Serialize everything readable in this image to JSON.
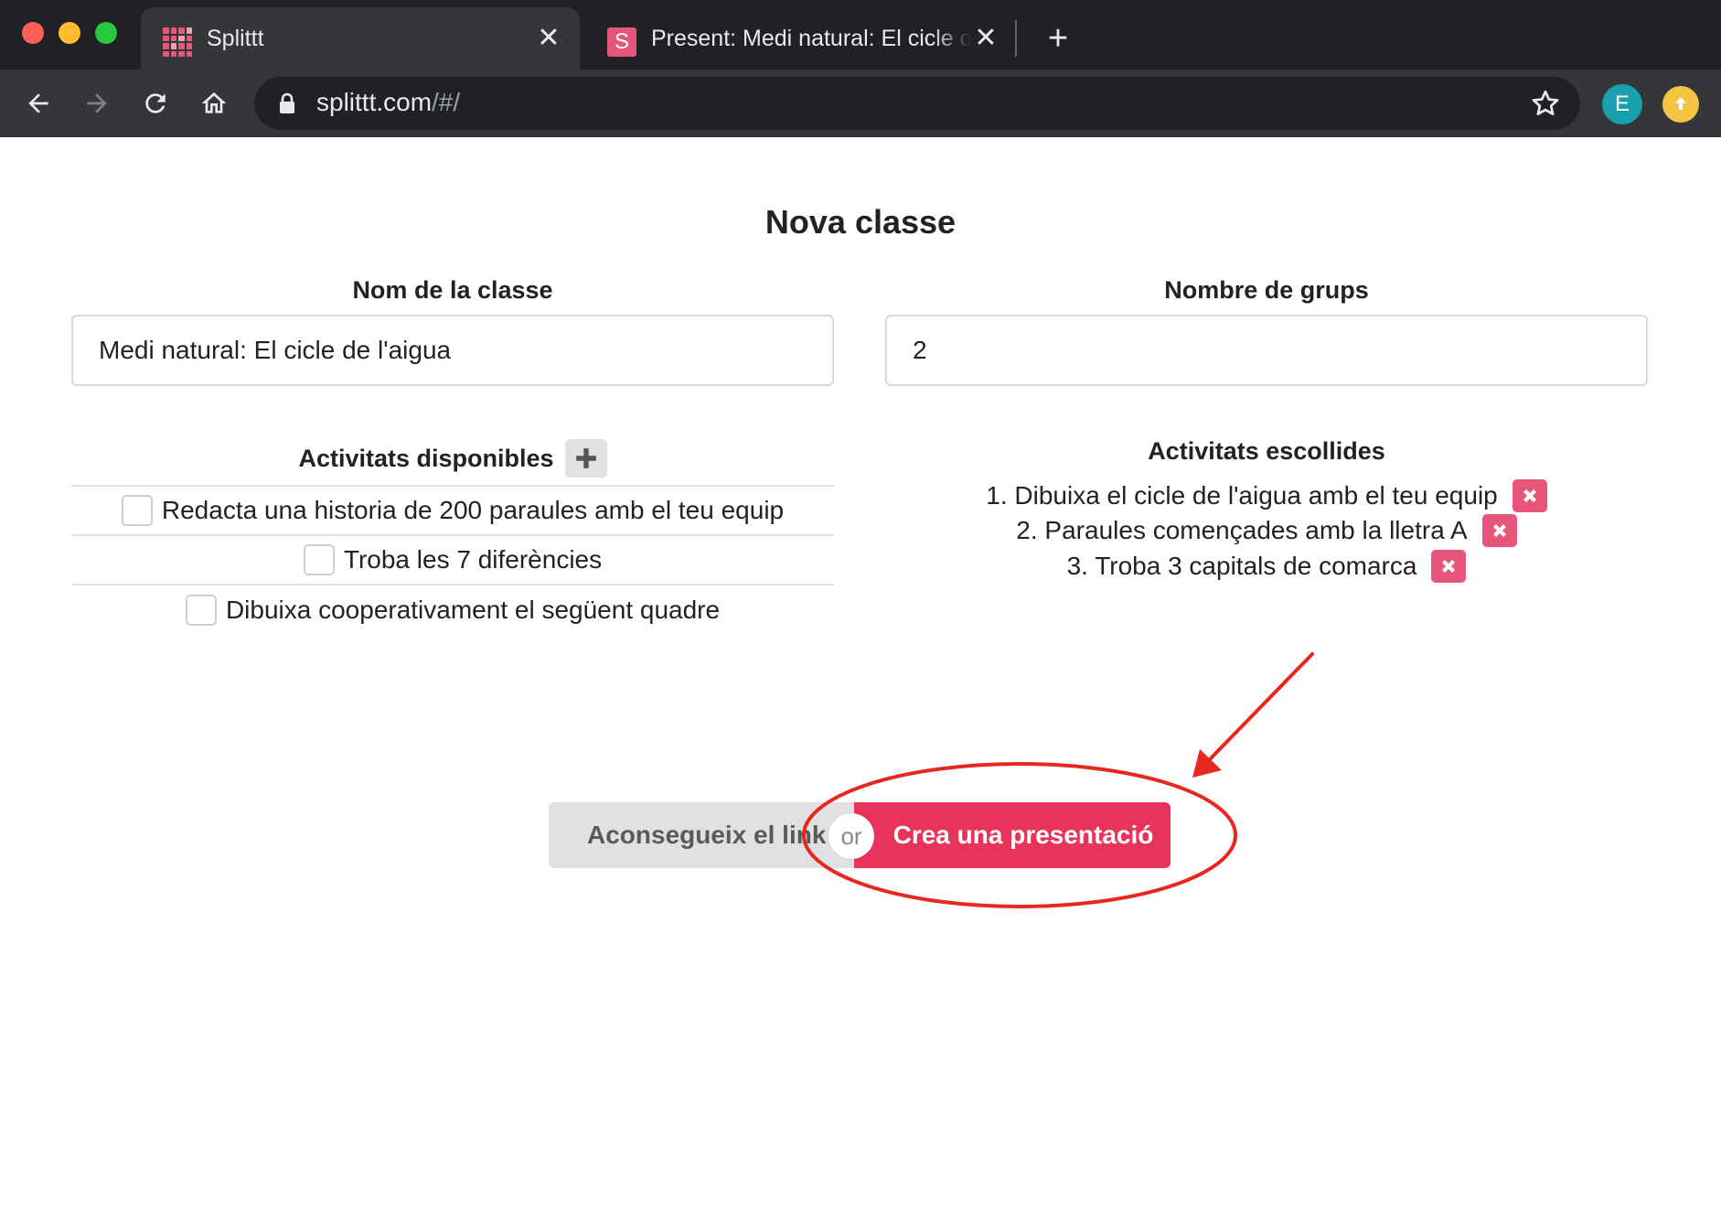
{
  "browser": {
    "tabs": [
      {
        "title": "Splittt",
        "favicon": "splittt-grid-icon",
        "active": true
      },
      {
        "title": "Present: Medi natural: El cicle de l'aigua",
        "favicon_letter": "S",
        "active": false
      }
    ],
    "url_host": "splittt.com",
    "url_path": "/#/",
    "profile_initial": "E"
  },
  "page": {
    "title": "Nova classe",
    "class_name_label": "Nom de la classe",
    "class_name_value": "Medi natural: El cicle de l'aigua",
    "groups_label": "Nombre de grups",
    "groups_value": "2",
    "available_title": "Activitats disponibles",
    "available": [
      "Redacta una historia de 200 paraules amb el teu equip",
      "Troba les 7 diferències",
      "Dibuixa cooperativament el següent quadre"
    ],
    "chosen_title": "Activitats escollides",
    "chosen": [
      "1. Dibuixa el cicle de l'aigua amb el teu equip",
      "2. Paraules començades amb la lletra A",
      "3. Troba 3 capitals de comarca"
    ],
    "get_link_label": "Aconsegueix el link",
    "or_label": "or",
    "create_label": "Crea una presentació"
  },
  "colors": {
    "accent": "#e8335a",
    "remove": "#e8557a",
    "annotation": "#e8281e"
  }
}
